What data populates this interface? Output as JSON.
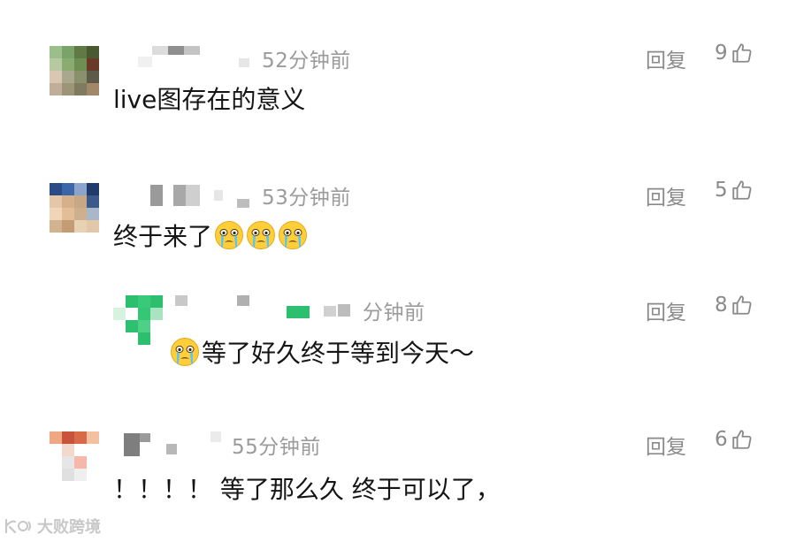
{
  "comments": [
    {
      "time": "52分钟前",
      "text": "live图存在的意义",
      "reply": "回复",
      "likes": "9"
    },
    {
      "time": "53分钟前",
      "text": "终于来了",
      "reply": "回复",
      "likes": "5",
      "emoji_count": 3
    },
    {
      "time": "分钟前",
      "text": "等了好久终于等到今天～",
      "reply": "回复",
      "likes": "8",
      "is_reply": true
    },
    {
      "time": "55分钟前",
      "text": "！！！！ 等了那么久 终于可以了，",
      "reply": "回复",
      "likes": "6"
    }
  ],
  "watermark": {
    "text": "大败跨境",
    "icon": "watermark-logo-icon"
  },
  "icons": {
    "like": "thumbs-up-icon",
    "emoji": "crying-face-emoji-icon"
  }
}
